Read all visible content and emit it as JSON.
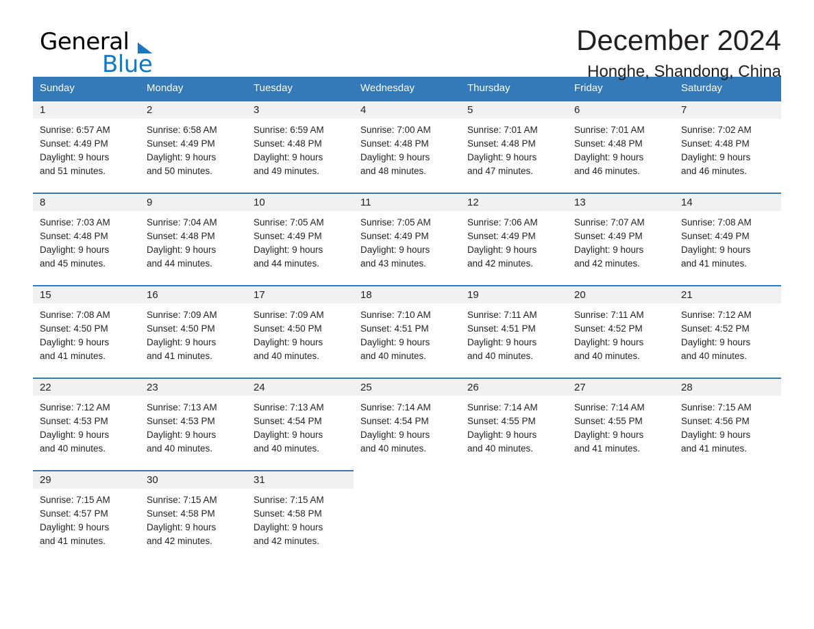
{
  "brand": {
    "word_one": "General",
    "word_two": "Blue",
    "triangle_color": "#1b75bb",
    "blue_color": "#0f7ac4"
  },
  "header": {
    "month_title": "December 2024",
    "location": "Honghe, Shandong, China",
    "header_bg": "#3479b8",
    "daynum_bg": "#f1f1f1"
  },
  "weekday_headers": [
    "Sunday",
    "Monday",
    "Tuesday",
    "Wednesday",
    "Thursday",
    "Friday",
    "Saturday"
  ],
  "labels": {
    "sunrise_prefix": "Sunrise:",
    "sunset_prefix": "Sunset:",
    "daylight_prefix": "Daylight:"
  },
  "weeks": [
    [
      {
        "day": "1",
        "sunrise": "Sunrise: 6:57 AM",
        "sunset": "Sunset: 4:49 PM",
        "daylight_line1": "Daylight: 9 hours",
        "daylight_line2": "and 51 minutes."
      },
      {
        "day": "2",
        "sunrise": "Sunrise: 6:58 AM",
        "sunset": "Sunset: 4:49 PM",
        "daylight_line1": "Daylight: 9 hours",
        "daylight_line2": "and 50 minutes."
      },
      {
        "day": "3",
        "sunrise": "Sunrise: 6:59 AM",
        "sunset": "Sunset: 4:48 PM",
        "daylight_line1": "Daylight: 9 hours",
        "daylight_line2": "and 49 minutes."
      },
      {
        "day": "4",
        "sunrise": "Sunrise: 7:00 AM",
        "sunset": "Sunset: 4:48 PM",
        "daylight_line1": "Daylight: 9 hours",
        "daylight_line2": "and 48 minutes."
      },
      {
        "day": "5",
        "sunrise": "Sunrise: 7:01 AM",
        "sunset": "Sunset: 4:48 PM",
        "daylight_line1": "Daylight: 9 hours",
        "daylight_line2": "and 47 minutes."
      },
      {
        "day": "6",
        "sunrise": "Sunrise: 7:01 AM",
        "sunset": "Sunset: 4:48 PM",
        "daylight_line1": "Daylight: 9 hours",
        "daylight_line2": "and 46 minutes."
      },
      {
        "day": "7",
        "sunrise": "Sunrise: 7:02 AM",
        "sunset": "Sunset: 4:48 PM",
        "daylight_line1": "Daylight: 9 hours",
        "daylight_line2": "and 46 minutes."
      }
    ],
    [
      {
        "day": "8",
        "sunrise": "Sunrise: 7:03 AM",
        "sunset": "Sunset: 4:48 PM",
        "daylight_line1": "Daylight: 9 hours",
        "daylight_line2": "and 45 minutes."
      },
      {
        "day": "9",
        "sunrise": "Sunrise: 7:04 AM",
        "sunset": "Sunset: 4:48 PM",
        "daylight_line1": "Daylight: 9 hours",
        "daylight_line2": "and 44 minutes."
      },
      {
        "day": "10",
        "sunrise": "Sunrise: 7:05 AM",
        "sunset": "Sunset: 4:49 PM",
        "daylight_line1": "Daylight: 9 hours",
        "daylight_line2": "and 44 minutes."
      },
      {
        "day": "11",
        "sunrise": "Sunrise: 7:05 AM",
        "sunset": "Sunset: 4:49 PM",
        "daylight_line1": "Daylight: 9 hours",
        "daylight_line2": "and 43 minutes."
      },
      {
        "day": "12",
        "sunrise": "Sunrise: 7:06 AM",
        "sunset": "Sunset: 4:49 PM",
        "daylight_line1": "Daylight: 9 hours",
        "daylight_line2": "and 42 minutes."
      },
      {
        "day": "13",
        "sunrise": "Sunrise: 7:07 AM",
        "sunset": "Sunset: 4:49 PM",
        "daylight_line1": "Daylight: 9 hours",
        "daylight_line2": "and 42 minutes."
      },
      {
        "day": "14",
        "sunrise": "Sunrise: 7:08 AM",
        "sunset": "Sunset: 4:49 PM",
        "daylight_line1": "Daylight: 9 hours",
        "daylight_line2": "and 41 minutes."
      }
    ],
    [
      {
        "day": "15",
        "sunrise": "Sunrise: 7:08 AM",
        "sunset": "Sunset: 4:50 PM",
        "daylight_line1": "Daylight: 9 hours",
        "daylight_line2": "and 41 minutes."
      },
      {
        "day": "16",
        "sunrise": "Sunrise: 7:09 AM",
        "sunset": "Sunset: 4:50 PM",
        "daylight_line1": "Daylight: 9 hours",
        "daylight_line2": "and 41 minutes."
      },
      {
        "day": "17",
        "sunrise": "Sunrise: 7:09 AM",
        "sunset": "Sunset: 4:50 PM",
        "daylight_line1": "Daylight: 9 hours",
        "daylight_line2": "and 40 minutes."
      },
      {
        "day": "18",
        "sunrise": "Sunrise: 7:10 AM",
        "sunset": "Sunset: 4:51 PM",
        "daylight_line1": "Daylight: 9 hours",
        "daylight_line2": "and 40 minutes."
      },
      {
        "day": "19",
        "sunrise": "Sunrise: 7:11 AM",
        "sunset": "Sunset: 4:51 PM",
        "daylight_line1": "Daylight: 9 hours",
        "daylight_line2": "and 40 minutes."
      },
      {
        "day": "20",
        "sunrise": "Sunrise: 7:11 AM",
        "sunset": "Sunset: 4:52 PM",
        "daylight_line1": "Daylight: 9 hours",
        "daylight_line2": "and 40 minutes."
      },
      {
        "day": "21",
        "sunrise": "Sunrise: 7:12 AM",
        "sunset": "Sunset: 4:52 PM",
        "daylight_line1": "Daylight: 9 hours",
        "daylight_line2": "and 40 minutes."
      }
    ],
    [
      {
        "day": "22",
        "sunrise": "Sunrise: 7:12 AM",
        "sunset": "Sunset: 4:53 PM",
        "daylight_line1": "Daylight: 9 hours",
        "daylight_line2": "and 40 minutes."
      },
      {
        "day": "23",
        "sunrise": "Sunrise: 7:13 AM",
        "sunset": "Sunset: 4:53 PM",
        "daylight_line1": "Daylight: 9 hours",
        "daylight_line2": "and 40 minutes."
      },
      {
        "day": "24",
        "sunrise": "Sunrise: 7:13 AM",
        "sunset": "Sunset: 4:54 PM",
        "daylight_line1": "Daylight: 9 hours",
        "daylight_line2": "and 40 minutes."
      },
      {
        "day": "25",
        "sunrise": "Sunrise: 7:14 AM",
        "sunset": "Sunset: 4:54 PM",
        "daylight_line1": "Daylight: 9 hours",
        "daylight_line2": "and 40 minutes."
      },
      {
        "day": "26",
        "sunrise": "Sunrise: 7:14 AM",
        "sunset": "Sunset: 4:55 PM",
        "daylight_line1": "Daylight: 9 hours",
        "daylight_line2": "and 40 minutes."
      },
      {
        "day": "27",
        "sunrise": "Sunrise: 7:14 AM",
        "sunset": "Sunset: 4:55 PM",
        "daylight_line1": "Daylight: 9 hours",
        "daylight_line2": "and 41 minutes."
      },
      {
        "day": "28",
        "sunrise": "Sunrise: 7:15 AM",
        "sunset": "Sunset: 4:56 PM",
        "daylight_line1": "Daylight: 9 hours",
        "daylight_line2": "and 41 minutes."
      }
    ],
    [
      {
        "day": "29",
        "sunrise": "Sunrise: 7:15 AM",
        "sunset": "Sunset: 4:57 PM",
        "daylight_line1": "Daylight: 9 hours",
        "daylight_line2": "and 41 minutes."
      },
      {
        "day": "30",
        "sunrise": "Sunrise: 7:15 AM",
        "sunset": "Sunset: 4:58 PM",
        "daylight_line1": "Daylight: 9 hours",
        "daylight_line2": "and 42 minutes."
      },
      {
        "day": "31",
        "sunrise": "Sunrise: 7:15 AM",
        "sunset": "Sunset: 4:58 PM",
        "daylight_line1": "Daylight: 9 hours",
        "daylight_line2": "and 42 minutes."
      },
      null,
      null,
      null,
      null
    ]
  ]
}
